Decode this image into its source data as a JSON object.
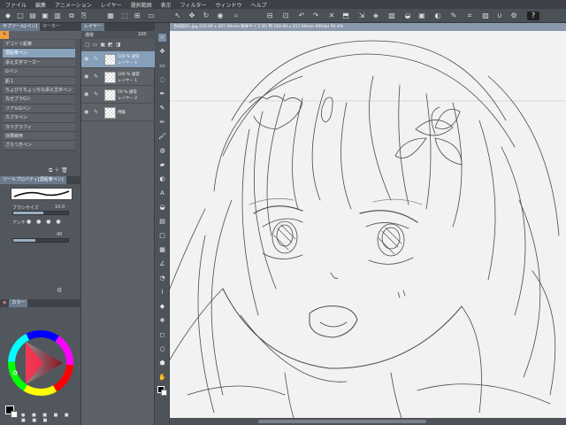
{
  "menu": [
    "ファイル",
    "編集",
    "アニメーション",
    "レイヤー",
    "選択範囲",
    "表示",
    "フィルター",
    "ウィンドウ",
    "ヘルプ"
  ],
  "left_panel": {
    "tabs": [
      "サブツール[ペン]",
      "マーカー"
    ],
    "brushes": [
      "デコトリ鉛筆",
      "濃鉛筆ペン",
      "添え文字マーカー",
      "Gペン",
      "鉛１",
      "ちょびりちょっちな添え文字ペン",
      "丸ゼブラGシ",
      "リアルGペン",
      "カブラペン",
      "カリグラフィ",
      "効果線用",
      "ざらつきペン"
    ],
    "selected_brush": 1,
    "tool_property_tab": "ツールプロパティ[濃鉛筆ペン]",
    "brush_size_label": "ブラシサイズ",
    "brush_size_value": "10.0",
    "brush_size_fill": 0.55,
    "ab_label": "アンチ",
    "aa_value": "40",
    "color_tab": "カラー"
  },
  "layer_panel": {
    "tab": "レイヤー",
    "blend_mode": "通常",
    "opacity": "100",
    "layers": [
      {
        "line1": "100 % 通常",
        "line2": "レイヤー 1",
        "selected": true
      },
      {
        "line1": "100 % 通常",
        "line2": "レイヤー 1",
        "selected": false
      },
      {
        "line1": "50 % 通常",
        "line2": "レイヤー 2",
        "selected": false
      },
      {
        "line1": "",
        "line2": "用紙",
        "selected": false
      }
    ]
  },
  "canvas": {
    "status": "合同誌01.jpg 210.00 x 297.00mm 製本サイズ B5 判 182.00 x 257.00mm 600dpi 59.4%"
  },
  "colors": {
    "accent": "#86a0bb",
    "canvas_bg": "#f2f2f2",
    "panel_bg": "#52575e"
  }
}
